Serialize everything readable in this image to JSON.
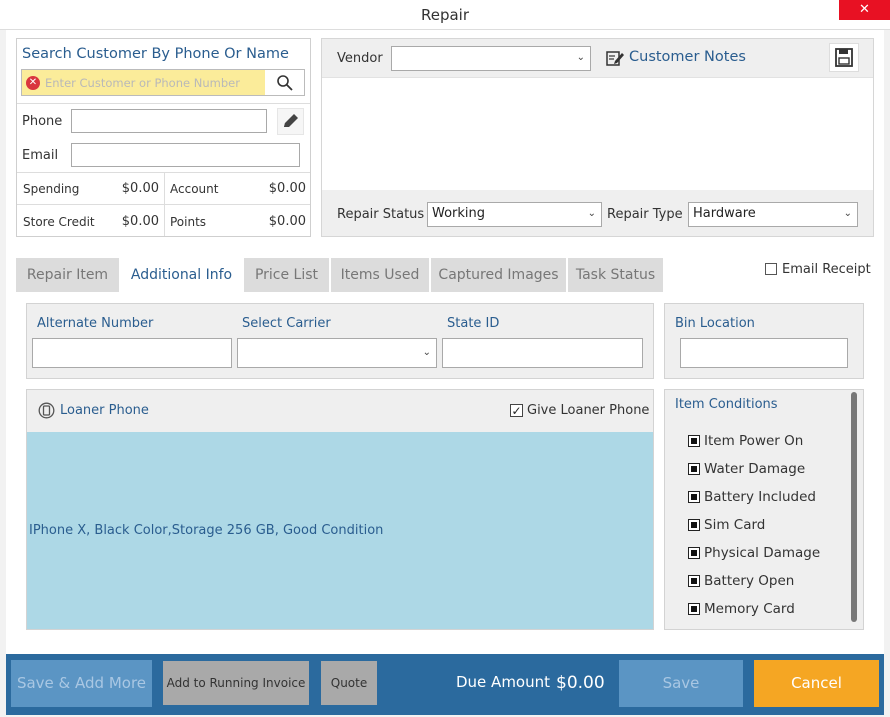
{
  "window": {
    "title": "Repair",
    "close_glyph": "✕"
  },
  "customer": {
    "search_title": "Search Customer By Phone Or Name",
    "search_placeholder": "Enter Customer or Phone Number",
    "phone_label": "Phone",
    "email_label": "Email",
    "spending_label": "Spending",
    "spending_value": "$0.00",
    "account_label": "Account",
    "account_value": "$0.00",
    "store_credit_label": "Store Credit",
    "store_credit_value": "$0.00",
    "points_label": "Points",
    "points_value": "$0.00"
  },
  "vendor": {
    "label": "Vendor",
    "value": "",
    "notes_label": "Customer Notes",
    "repair_status_label": "Repair Status",
    "repair_status_value": "Working",
    "repair_type_label": "Repair Type",
    "repair_type_value": "Hardware"
  },
  "tabs": [
    {
      "label": "Repair Item"
    },
    {
      "label": "Additional Info"
    },
    {
      "label": "Price List"
    },
    {
      "label": "Items Used"
    },
    {
      "label": "Captured Images"
    },
    {
      "label": "Task Status"
    }
  ],
  "email_receipt_label": "Email Receipt",
  "additional": {
    "alternate_number_label": "Alternate Number",
    "select_carrier_label": "Select Carrier",
    "state_id_label": "State ID",
    "bin_location_label": "Bin Location"
  },
  "loaner": {
    "title": "Loaner Phone",
    "give_label": "Give Loaner Phone",
    "give_checked": true,
    "description": "IPhone X, Black Color,Storage 256 GB, Good Condition"
  },
  "item_conditions": {
    "title": "Item Conditions",
    "items": [
      "Item Power On",
      "Water Damage",
      "Battery Included",
      "Sim Card",
      "Physical Damage",
      "Battery Open",
      "Memory Card"
    ]
  },
  "footer": {
    "save_add_more": "Save & Add More",
    "add_running_invoice": "Add to Running Invoice",
    "quote": "Quote",
    "due_amount_label": "Due Amount",
    "due_amount_value": "$0.00",
    "save": "Save",
    "cancel": "Cancel"
  },
  "colors": {
    "accent_blue": "#2a5d8f",
    "footer_bg": "#2b6a9e",
    "cancel_orange": "#f5a623",
    "loaner_bg": "#add8e6",
    "search_highlight": "#fbec9a"
  }
}
